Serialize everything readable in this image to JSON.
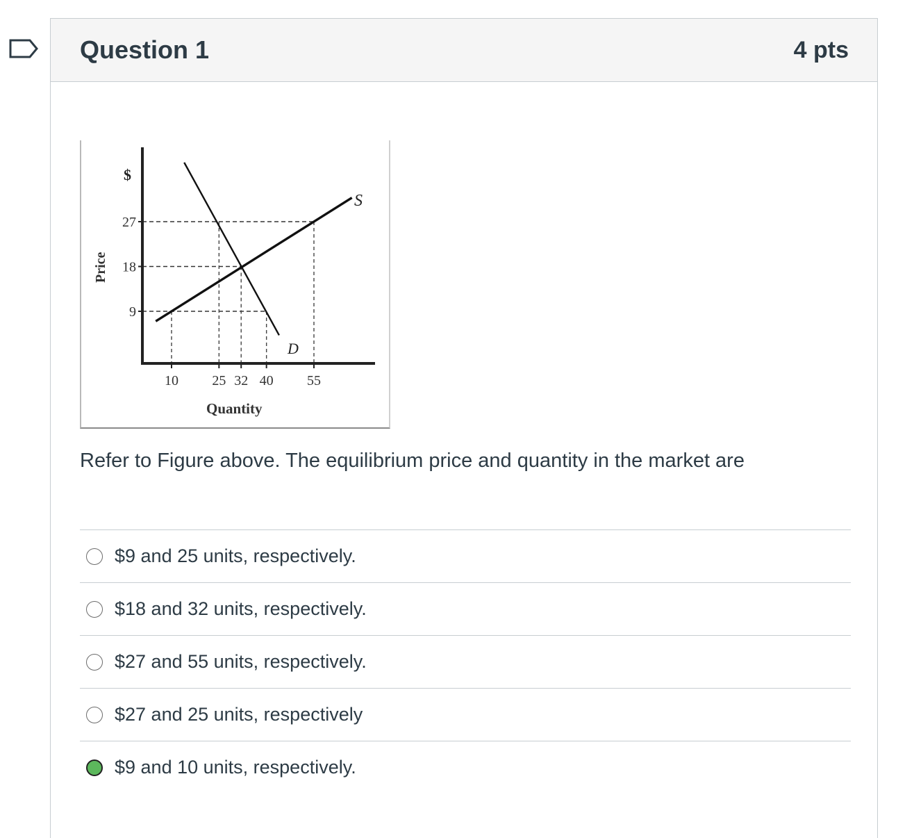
{
  "question": {
    "title": "Question 1",
    "points": "4 pts",
    "text": "Refer to Figure above. The equilibrium price and quantity in the market are"
  },
  "figure": {
    "y_unit": "$",
    "y_label": "Price",
    "x_label": "Quantity",
    "demand_label": "D",
    "supply_label": "S"
  },
  "chart_data": {
    "type": "line",
    "title": "",
    "xlabel": "Quantity",
    "ylabel": "Price",
    "y_unit": "$",
    "x_ticks": [
      10,
      25,
      32,
      40,
      55
    ],
    "y_ticks": [
      9,
      18,
      27
    ],
    "series": [
      {
        "name": "S",
        "points": [
          [
            10,
            9
          ],
          [
            25,
            13.5
          ],
          [
            32,
            18
          ],
          [
            55,
            27
          ]
        ]
      },
      {
        "name": "D",
        "points": [
          [
            25,
            27
          ],
          [
            32,
            18
          ],
          [
            40,
            9
          ]
        ]
      }
    ],
    "grid": "dashed guide lines at tick values"
  },
  "answers": [
    {
      "label": "$9 and 25 units, respectively.",
      "selected": false
    },
    {
      "label": "$18 and 32 units, respectively.",
      "selected": false
    },
    {
      "label": "$27 and 55 units, respectively.",
      "selected": false
    },
    {
      "label": "$27 and 25 units, respectively",
      "selected": false
    },
    {
      "label": "$9 and 10 units, respectively.",
      "selected": true
    }
  ],
  "colors": {
    "selected_radio": "#5cb85c",
    "text": "#2d3b45",
    "border": "#c7cdd1"
  }
}
